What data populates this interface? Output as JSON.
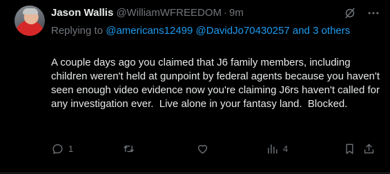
{
  "tweet": {
    "display_name": "Jason Wallis",
    "handle": "@WilliamWFREEDOM",
    "separator": "·",
    "time": "9m",
    "replying_prefix": "Replying to ",
    "mention1": "@americans12499",
    "mention2": "@DavidJo70430257",
    "and_others": "and 3 others",
    "text": "A couple days ago you claimed that J6 family members, including children weren't held at gunpoint by federal agents because you haven't seen enough video evidence now you're claiming J6rs haven't called for any investigation ever.  Live alone in your fantasy land.  Blocked."
  },
  "actions": {
    "reply_count": "1",
    "retweet_count": "",
    "like_count": "",
    "views_count": "4"
  },
  "colors": {
    "background": "#000000",
    "text": "#e7e9ea",
    "muted": "#71767b",
    "link": "#1d9bf0"
  },
  "icons": [
    "grok-icon",
    "more-icon",
    "reply-icon",
    "retweet-icon",
    "like-icon",
    "views-icon",
    "bookmark-icon",
    "share-icon"
  ]
}
